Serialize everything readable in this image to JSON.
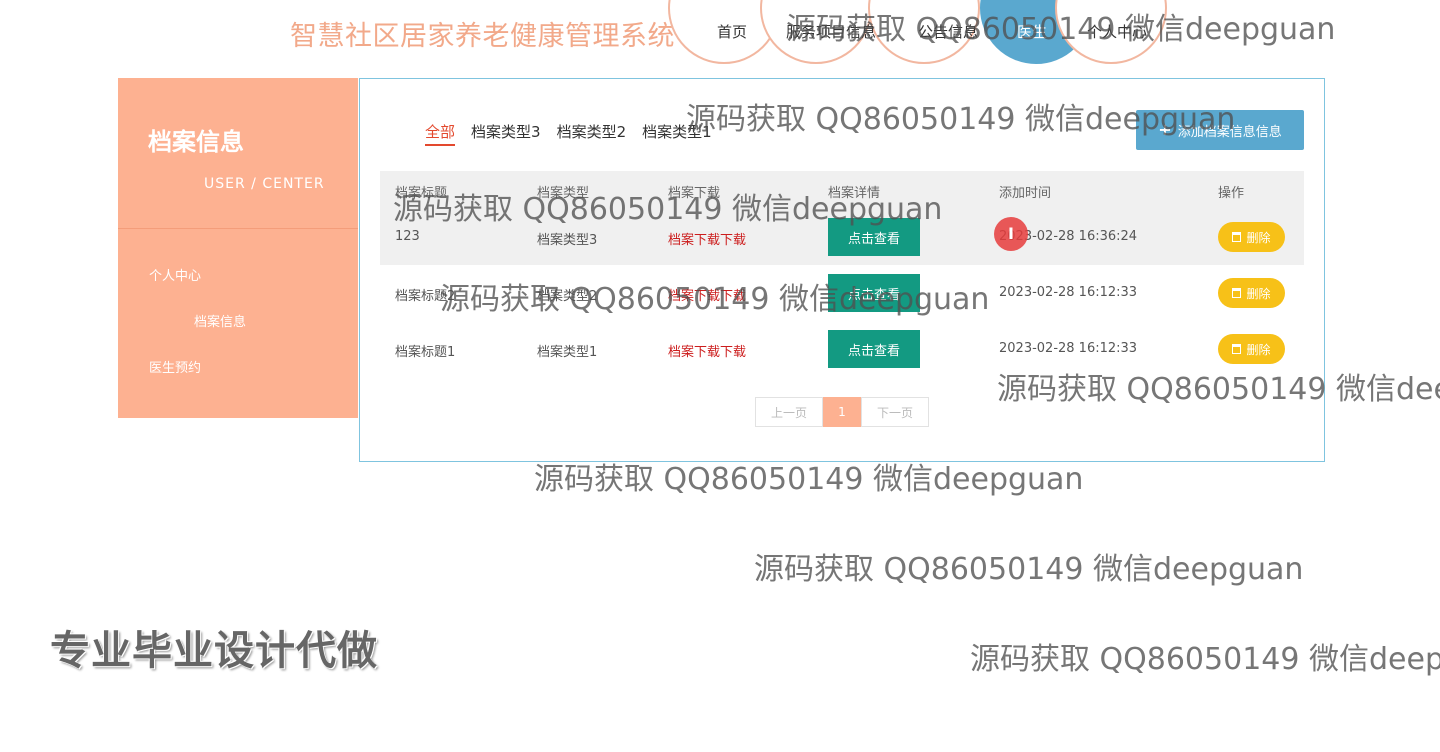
{
  "header": {
    "site_title": "智慧社区居家养老健康管理系统",
    "nav": [
      {
        "label": "首页"
      },
      {
        "label": "服务项目信息"
      },
      {
        "label": "公告信息"
      },
      {
        "label": "医生"
      },
      {
        "label": "个人中心"
      }
    ],
    "active_nav": "医生"
  },
  "sidebar": {
    "title": "档案信息",
    "subtitle": "USER / CENTER",
    "items": [
      {
        "label": "个人中心"
      },
      {
        "label": "档案信息"
      },
      {
        "label": "医生预约"
      }
    ]
  },
  "main": {
    "tabs": [
      {
        "label": "全部"
      },
      {
        "label": "档案类型3"
      },
      {
        "label": "档案类型2"
      },
      {
        "label": "档案类型1"
      }
    ],
    "active_tab": "全部",
    "add_button": "添加档案信息信息",
    "table": {
      "headers": [
        "档案标题",
        "档案类型",
        "档案下载",
        "档案详情",
        "添加时间",
        "操作"
      ],
      "rows": [
        {
          "title": "123",
          "type": "档案类型3",
          "download": "档案下载下载",
          "detail": "点击查看",
          "time": "2023-02-28 16:36:24",
          "action": "删除"
        },
        {
          "title": "档案标题2",
          "type": "档案类型2",
          "download": "档案下载下载",
          "detail": "点击查看",
          "time": "2023-02-28 16:12:33",
          "action": "删除"
        },
        {
          "title": "档案标题1",
          "type": "档案类型1",
          "download": "档案下载下载",
          "detail": "点击查看",
          "time": "2023-02-28 16:12:33",
          "action": "删除"
        }
      ]
    },
    "pagination": {
      "prev": "上一页",
      "page": "1",
      "next": "下一页"
    }
  },
  "cursor_glyph": "I",
  "watermark": "源码获取 QQ86050149 微信deepguan",
  "promo_text": "专业毕业设计代做",
  "colors": {
    "accent": "#fdb191",
    "title": "#f2a98a",
    "primary_blue": "#5aa8cf",
    "view_button": "#139a82",
    "delete_button": "#f7c118",
    "download_link": "#cc1d1d",
    "active_tab": "#e3492e"
  }
}
